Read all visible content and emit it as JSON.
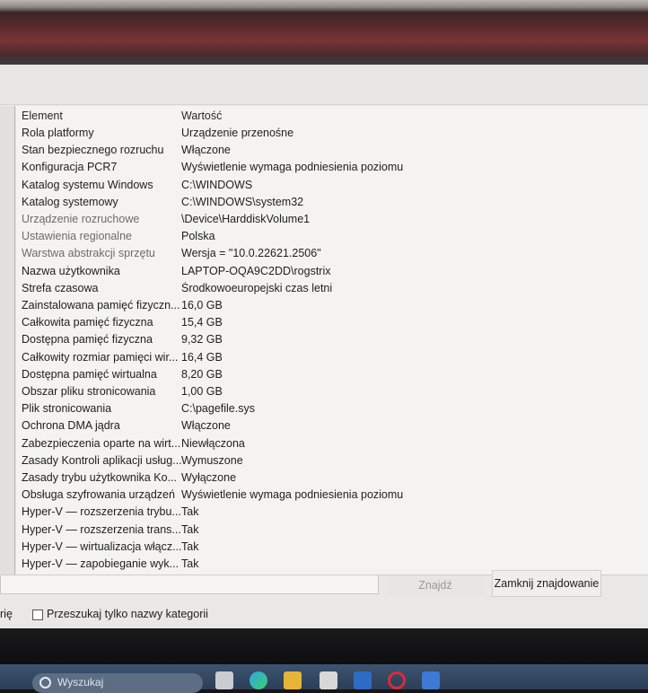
{
  "list": {
    "columns": {
      "element": "Element",
      "value": "Wartość"
    },
    "rows": [
      {
        "element": "Rola platformy",
        "value": "Urządzenie przenośne"
      },
      {
        "element": "Stan bezpiecznego rozruchu",
        "value": "Włączone"
      },
      {
        "element": "Konfiguracja PCR7",
        "value": "Wyświetlenie wymaga podniesienia poziomu"
      },
      {
        "element": "Katalog systemu Windows",
        "value": "C:\\WINDOWS"
      },
      {
        "element": "Katalog systemowy",
        "value": "C:\\WINDOWS\\system32"
      },
      {
        "element": "Urządzenie rozruchowe",
        "value": "\\Device\\HarddiskVolume1"
      },
      {
        "element": "Ustawienia regionalne",
        "value": "Polska"
      },
      {
        "element": "Warstwa abstrakcji sprzętu",
        "value": "Wersja = \"10.0.22621.2506\""
      },
      {
        "element": "Nazwa użytkownika",
        "value": "LAPTOP-OQA9C2DD\\rogstrix"
      },
      {
        "element": "Strefa czasowa",
        "value": "Środkowoeuropejski czas letni"
      },
      {
        "element": "Zainstalowana pamięć fizyczn...",
        "value": "16,0 GB"
      },
      {
        "element": "Całkowita pamięć fizyczna",
        "value": "15,4 GB"
      },
      {
        "element": "Dostępna pamięć fizyczna",
        "value": "9,32 GB"
      },
      {
        "element": "Całkowity rozmiar pamięci wir...",
        "value": "16,4 GB"
      },
      {
        "element": "Dostępna pamięć wirtualna",
        "value": "8,20 GB"
      },
      {
        "element": "Obszar pliku stronicowania",
        "value": "1,00 GB"
      },
      {
        "element": "Plik stronicowania",
        "value": "C:\\pagefile.sys"
      },
      {
        "element": "Ochrona DMA jądra",
        "value": "Włączone"
      },
      {
        "element": "Zabezpieczenia oparte na wirt...",
        "value": "Niewłączona"
      },
      {
        "element": "Zasady Kontroli aplikacji usług...",
        "value": "Wymuszone"
      },
      {
        "element": "Zasady trybu użytkownika Ko...",
        "value": "Wyłączone"
      },
      {
        "element": "Obsługa szyfrowania urządzeń",
        "value": "Wyświetlenie wymaga podniesienia poziomu"
      },
      {
        "element": "Hyper-V — rozszerzenia trybu...",
        "value": "Tak"
      },
      {
        "element": "Hyper-V — rozszerzenia trans...",
        "value": "Tak"
      },
      {
        "element": "Hyper-V — wirtualizacja włącz...",
        "value": "Tak"
      },
      {
        "element": "Hyper-V — zapobieganie wyk...",
        "value": "Tak"
      }
    ]
  },
  "find_bar": {
    "find_label": "Znajdź",
    "close_find_label": "Zamknij znajdowanie",
    "truncated_label": "rię",
    "search_categories_label": "Przeszukaj tylko nazwy kategorii",
    "search_categories_checked": false
  },
  "taskbar": {
    "search_placeholder": "Wyszukaj",
    "icons": [
      "search-icon",
      "file-explorer-icon",
      "edge-icon",
      "folder-icon",
      "app-icon",
      "opera-icon",
      "settings-icon"
    ]
  },
  "colors": {
    "window_bg": "#ebe9e8",
    "list_bg": "#f4f3f2",
    "taskbar": "#2c3e56"
  }
}
